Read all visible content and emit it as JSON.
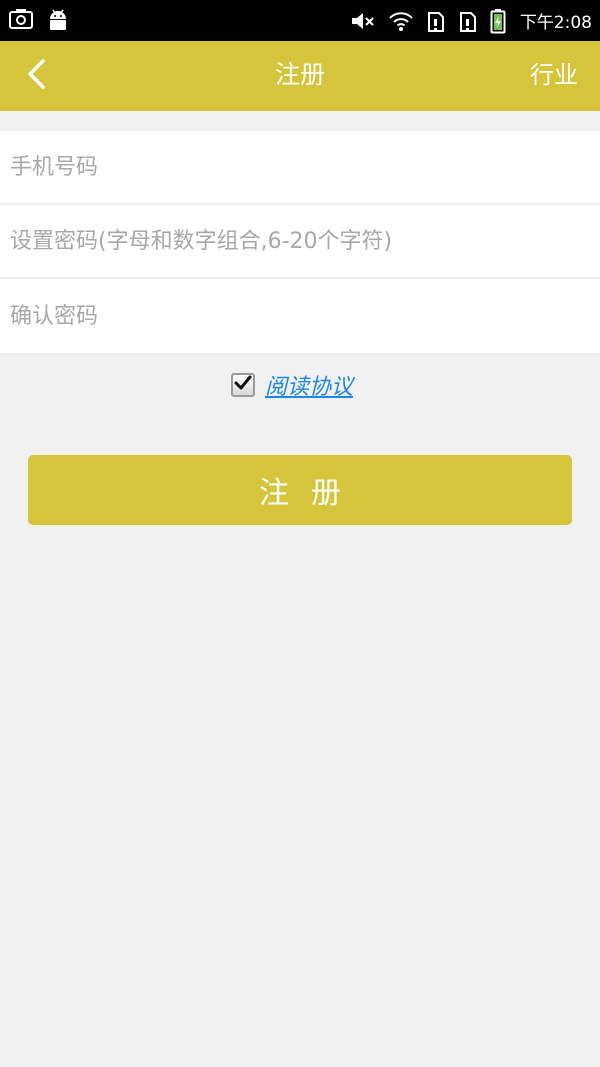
{
  "status_bar": {
    "time": "下午2:08",
    "icons": [
      "screenshot-icon",
      "android-icon",
      "mute-icon",
      "wifi-icon",
      "sim-1-icon",
      "sim-2-icon",
      "battery-charging-icon"
    ]
  },
  "app_bar": {
    "title": "注册",
    "right_action": "行业",
    "back_icon": "chevron-left-icon"
  },
  "form": {
    "phone_placeholder": "手机号码",
    "password_placeholder": "设置密码(字母和数字组合,6-20个字符)",
    "confirm_placeholder": "确认密码"
  },
  "agreement": {
    "checked": true,
    "label": "阅读协议"
  },
  "submit": {
    "label": "注册"
  },
  "colors": {
    "accent": "#d6c43a",
    "background": "#f1f1f1",
    "link": "#1e88e5"
  }
}
